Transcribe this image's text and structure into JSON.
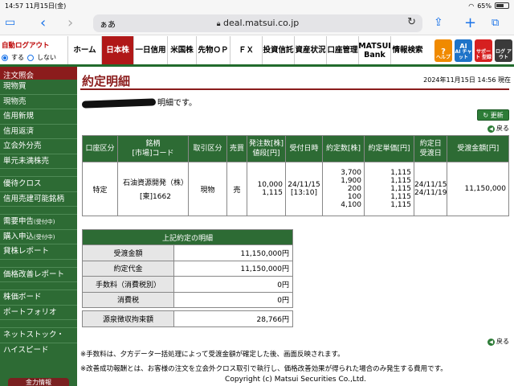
{
  "status": {
    "time": "14:57",
    "date": "11月15日(金)",
    "battery": "65%",
    "battery_level": 0.65
  },
  "browser": {
    "aa": "ぁあ",
    "url": "deal.matsui.co.jp"
  },
  "login": {
    "title": "自動ログアウト",
    "on": "する",
    "off": "しない"
  },
  "tabs": [
    {
      "label": "ホーム",
      "w": 42
    },
    {
      "label": "日本株",
      "w": 40
    },
    {
      "label": "一日信用",
      "w": 42
    },
    {
      "label": "米国株",
      "w": 36
    },
    {
      "label": "先物ＯＰ",
      "w": 42
    },
    {
      "label": "ＦＸ",
      "w": 40
    },
    {
      "label": "投資信託",
      "w": 40
    },
    {
      "label": "資産状況",
      "w": 40
    },
    {
      "label": "口座管理",
      "w": 40
    },
    {
      "label": "MATSUI Bank",
      "w": 40
    },
    {
      "label": "情報検索",
      "w": 42
    }
  ],
  "icons": {
    "help": "ヘルプ",
    "ai": "AI チャット",
    "support": "サポート 型録",
    "logout": "ログ アウト"
  },
  "sidebar": {
    "head": "注文照会",
    "items": [
      "現物買",
      "現物売",
      "信用新規",
      "信用返済",
      "立会外分売",
      "単元未満株売"
    ],
    "items2": [
      "優待クロス",
      "信用売建可能銘柄"
    ],
    "items3": [
      {
        "t": "需要申告",
        "s": "(受付中)"
      },
      {
        "t": "購入申込",
        "s": "(受付中)"
      },
      {
        "t": "貸株レポート",
        "s": ""
      }
    ],
    "items4": [
      "価格改善レポート"
    ],
    "items5": [
      "株価ボード",
      "ポートフォリオ"
    ],
    "items6": [
      "ネットストック・",
      "ハイスピード"
    ],
    "bottom": "金力情報"
  },
  "main": {
    "title": "約定明細",
    "datetime": "2024年11月15日 14:56 現在",
    "message": "明細です。",
    "refresh": "更新",
    "back": "戻る"
  },
  "table": {
    "headers": [
      "口座区分",
      "銘柄\n[市場]コード",
      "取引区分",
      "売買",
      "発注数[株]\n値段[円]",
      "受付日時",
      "約定数[株]",
      "約定単価[円]",
      "約定日\n受渡日",
      "受渡金額[円]"
    ],
    "row": {
      "account": "特定",
      "stock": "石油資源開発（株）",
      "code": "[東]1662",
      "kind": "現物",
      "side": "売",
      "order_qty": "10,000",
      "order_price": "1,115",
      "received": "24/11/15",
      "received_time": "[13:10]",
      "exec_qty": [
        "3,700",
        "1,900",
        "200",
        "100",
        "4,100"
      ],
      "exec_price": [
        "1,115",
        "1,115",
        "1,115",
        "1,115",
        "1,115"
      ],
      "exec_date": "24/11/15",
      "settle_date": "24/11/19",
      "amount": "11,150,000"
    }
  },
  "detail": {
    "header": "上記約定の明細",
    "rows": [
      {
        "label": "受渡金額",
        "value": "11,150,000円"
      },
      {
        "label": "約定代金",
        "value": "11,150,000円"
      },
      {
        "label": "手数料（消費税別）",
        "value": "0円"
      },
      {
        "label": "消費税",
        "value": "0円"
      }
    ],
    "tax": {
      "label": "源泉徴収拘束額",
      "value": "28,766円"
    }
  },
  "notes": [
    "※手数料は、夕方データ一括処理によって受渡金額が確定した後、画面反映されます。",
    "※改善成功報酬とは、お客様の注文を立会外クロス取引で執行し、価格改善効果が得られた場合のみ発生する費用です。"
  ],
  "copyright": "Copyright (c) Matsui Securities Co.,Ltd."
}
